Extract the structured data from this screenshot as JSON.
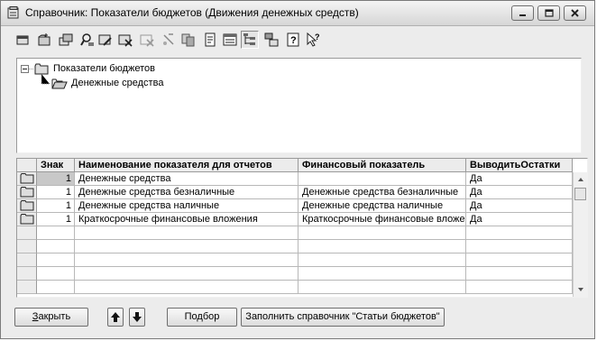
{
  "window": {
    "title": "Справочник: Показатели бюджетов (Движения денежных средств)"
  },
  "toolbar": {
    "icons": [
      "new-item-icon",
      "new-group-icon",
      "copy-item-icon",
      "find-icon",
      "edit-icon",
      "delete-icon",
      "mark-delete-icon",
      "copy-icon",
      "properties-icon",
      "move-icon",
      "hierarchy-icon",
      "list-icon",
      "help-icon",
      "context-help-icon"
    ]
  },
  "tree": {
    "root_label": "Показатели бюджетов",
    "child_label": "Денежные средства"
  },
  "table": {
    "columns": [
      "Знак",
      "Наименование показателя для отчетов",
      "Финансовый показатель",
      "ВыводитьОстатки"
    ],
    "rows": [
      {
        "sign": "1",
        "name": "Денежные средства",
        "fin": "",
        "show": "Да"
      },
      {
        "sign": "1",
        "name": "Денежные средства безналичные",
        "fin": "Денежные средства безналичные",
        "show": "Да"
      },
      {
        "sign": "1",
        "name": "Денежные средства наличные",
        "fin": "Денежные средства наличные",
        "show": "Да"
      },
      {
        "sign": "1",
        "name": "Краткосрочные финансовые вложения",
        "fin": "Краткосрочные финансовые вложе",
        "show": "Да"
      }
    ]
  },
  "buttons": {
    "close_prefix": "",
    "close_underlined": "З",
    "close_rest": "акрыть",
    "select_label": "Подбор",
    "fill_label": "Заполнить справочник \"Статьи бюджетов\""
  }
}
